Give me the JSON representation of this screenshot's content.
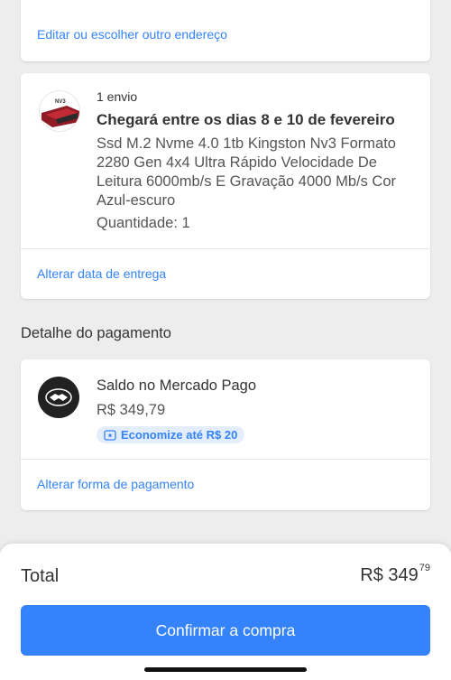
{
  "address_card": {
    "edit_link": "Editar ou escolher outro endereço"
  },
  "shipment_card": {
    "shipment_count": "1 envio",
    "delivery_title": "Chegará entre os dias 8 e 10 de fevereiro",
    "product_name": "Ssd M.2 Nvme 4.0 1tb Kingston Nv3 Formato 2280 Gen 4x4 Ultra Rápido Velocidade De Leitura 6000mb/s E Gravação 4000 Mb/s Cor Azul-escuro",
    "quantity": "Quantidade: 1",
    "thumbnail_text": "NV3",
    "change_date_link": "Alterar data de entrega"
  },
  "payment_section": {
    "title": "Detalhe do pagamento"
  },
  "payment_card": {
    "method_title": "Saldo no Mercado Pago",
    "amount": "R$ 349,79",
    "savings_badge": "Economize até R$ 20",
    "change_payment_link": "Alterar forma de pagamento",
    "icon": "handshake-icon"
  },
  "footer": {
    "total_label": "Total",
    "total_main": "R$ 349",
    "total_cents": "79",
    "confirm_button": "Confirmar a compra"
  },
  "colors": {
    "accent": "#3483fa",
    "background": "#ededed",
    "badge_bg": "#e3edfb"
  }
}
